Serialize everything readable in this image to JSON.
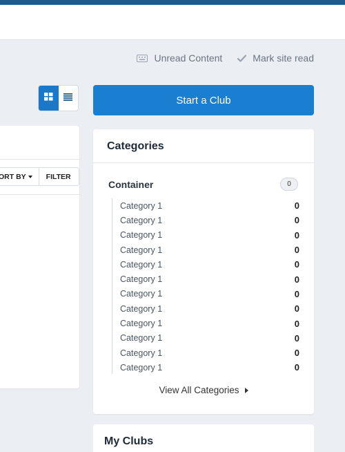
{
  "header": {
    "unread_label": "Unread Content",
    "mark_read_label": "Mark site read"
  },
  "toolbar": {
    "start_club_label": "Start a Club",
    "sort_label": "ORT BY",
    "filter_label": "FILTER"
  },
  "categories": {
    "title": "Categories",
    "container": {
      "name": "Container",
      "count": "0"
    },
    "items": [
      {
        "label": "Category 1",
        "count": "0"
      },
      {
        "label": "Category 1",
        "count": "0"
      },
      {
        "label": "Category 1",
        "count": "0"
      },
      {
        "label": "Category 1",
        "count": "0"
      },
      {
        "label": "Category 1",
        "count": "0"
      },
      {
        "label": "Category 1",
        "count": "0"
      },
      {
        "label": "Category 1",
        "count": "0"
      },
      {
        "label": "Category 1",
        "count": "0"
      },
      {
        "label": "Category 1",
        "count": "0"
      },
      {
        "label": "Category 1",
        "count": "0"
      },
      {
        "label": "Category 1",
        "count": "0"
      },
      {
        "label": "Category 1",
        "count": "0"
      }
    ],
    "view_all_label": "View All Categories"
  },
  "my_clubs": {
    "title": "My Clubs"
  },
  "colors": {
    "accent": "#1a7fd0",
    "topbar": "#1f5a8a",
    "background": "#ebeef2"
  },
  "icons": {
    "unread": "keyboard-icon",
    "mark_read": "check-icon",
    "grid_view": "grid-icon",
    "list_view": "list-icon"
  }
}
